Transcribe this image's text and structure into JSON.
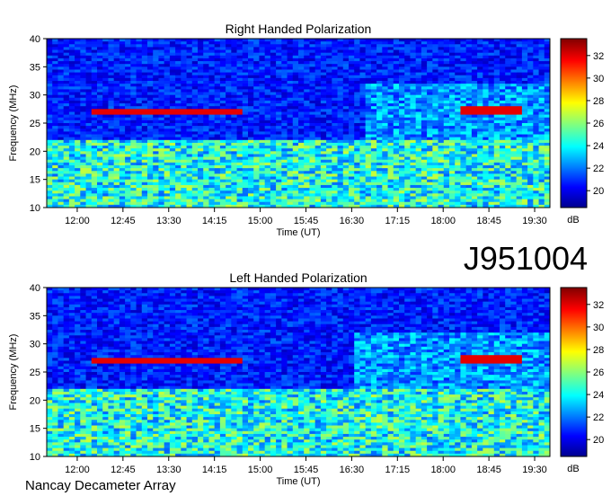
{
  "figure": {
    "event_id": "J951004",
    "footer": "Nancay Decameter Array"
  },
  "chart_data": [
    {
      "type": "heatmap",
      "title": "Right Handed Polarization",
      "xlabel": "Time (UT)",
      "ylabel": "Frequency (MHz)",
      "x_range_ut_hours": [
        11.5,
        19.75
      ],
      "x_ticks": [
        "12:00",
        "12:45",
        "13:30",
        "14:15",
        "15:00",
        "15:45",
        "16:30",
        "17:15",
        "18:00",
        "18:45",
        "19:30"
      ],
      "y_range_mhz": [
        10,
        40
      ],
      "y_ticks": [
        10,
        15,
        20,
        25,
        30,
        35,
        40
      ],
      "colorbar": {
        "label": "dB",
        "ticks": [
          20,
          22,
          24,
          26,
          28,
          30,
          32
        ],
        "range": [
          18.5,
          33.5
        ],
        "colormap": "jet"
      },
      "features": [
        {
          "desc": "intense band",
          "freq_mhz": [
            26.5,
            27.5
          ],
          "time_ut": [
            "12:15",
            "14:45"
          ],
          "level_db": 32
        },
        {
          "desc": "intense band",
          "freq_mhz": [
            26.5,
            27.8
          ],
          "time_ut": [
            "18:15",
            "19:15"
          ],
          "level_db": 32
        },
        {
          "desc": "broadband emission",
          "freq_mhz": [
            10,
            22
          ],
          "time_ut": [
            "11:30",
            "19:45"
          ],
          "level_db": 28
        },
        {
          "desc": "broadband emission",
          "freq_mhz": [
            15,
            32
          ],
          "time_ut": [
            "16:45",
            "19:45"
          ],
          "level_db": 25
        }
      ]
    },
    {
      "type": "heatmap",
      "title": "Left Handed Polarization",
      "xlabel": "Time (UT)",
      "ylabel": "Frequency (MHz)",
      "x_range_ut_hours": [
        11.5,
        19.75
      ],
      "x_ticks": [
        "12:00",
        "12:45",
        "13:30",
        "14:15",
        "15:00",
        "15:45",
        "16:30",
        "17:15",
        "18:00",
        "18:45",
        "19:30"
      ],
      "y_range_mhz": [
        10,
        40
      ],
      "y_ticks": [
        10,
        15,
        20,
        25,
        30,
        35,
        40
      ],
      "colorbar": {
        "label": "dB",
        "ticks": [
          20,
          22,
          24,
          26,
          28,
          30,
          32
        ],
        "range": [
          18.5,
          33.5
        ],
        "colormap": "jet"
      },
      "features": [
        {
          "desc": "intense band",
          "freq_mhz": [
            26.5,
            27.5
          ],
          "time_ut": [
            "12:15",
            "14:45"
          ],
          "level_db": 32
        },
        {
          "desc": "intense band",
          "freq_mhz": [
            26.5,
            27.8
          ],
          "time_ut": [
            "18:15",
            "19:15"
          ],
          "level_db": 32
        },
        {
          "desc": "broadband emission",
          "freq_mhz": [
            10,
            22
          ],
          "time_ut": [
            "11:30",
            "19:45"
          ],
          "level_db": 28
        },
        {
          "desc": "broadband emission",
          "freq_mhz": [
            15,
            32
          ],
          "time_ut": [
            "16:30",
            "19:45"
          ],
          "level_db": 25
        }
      ]
    }
  ]
}
